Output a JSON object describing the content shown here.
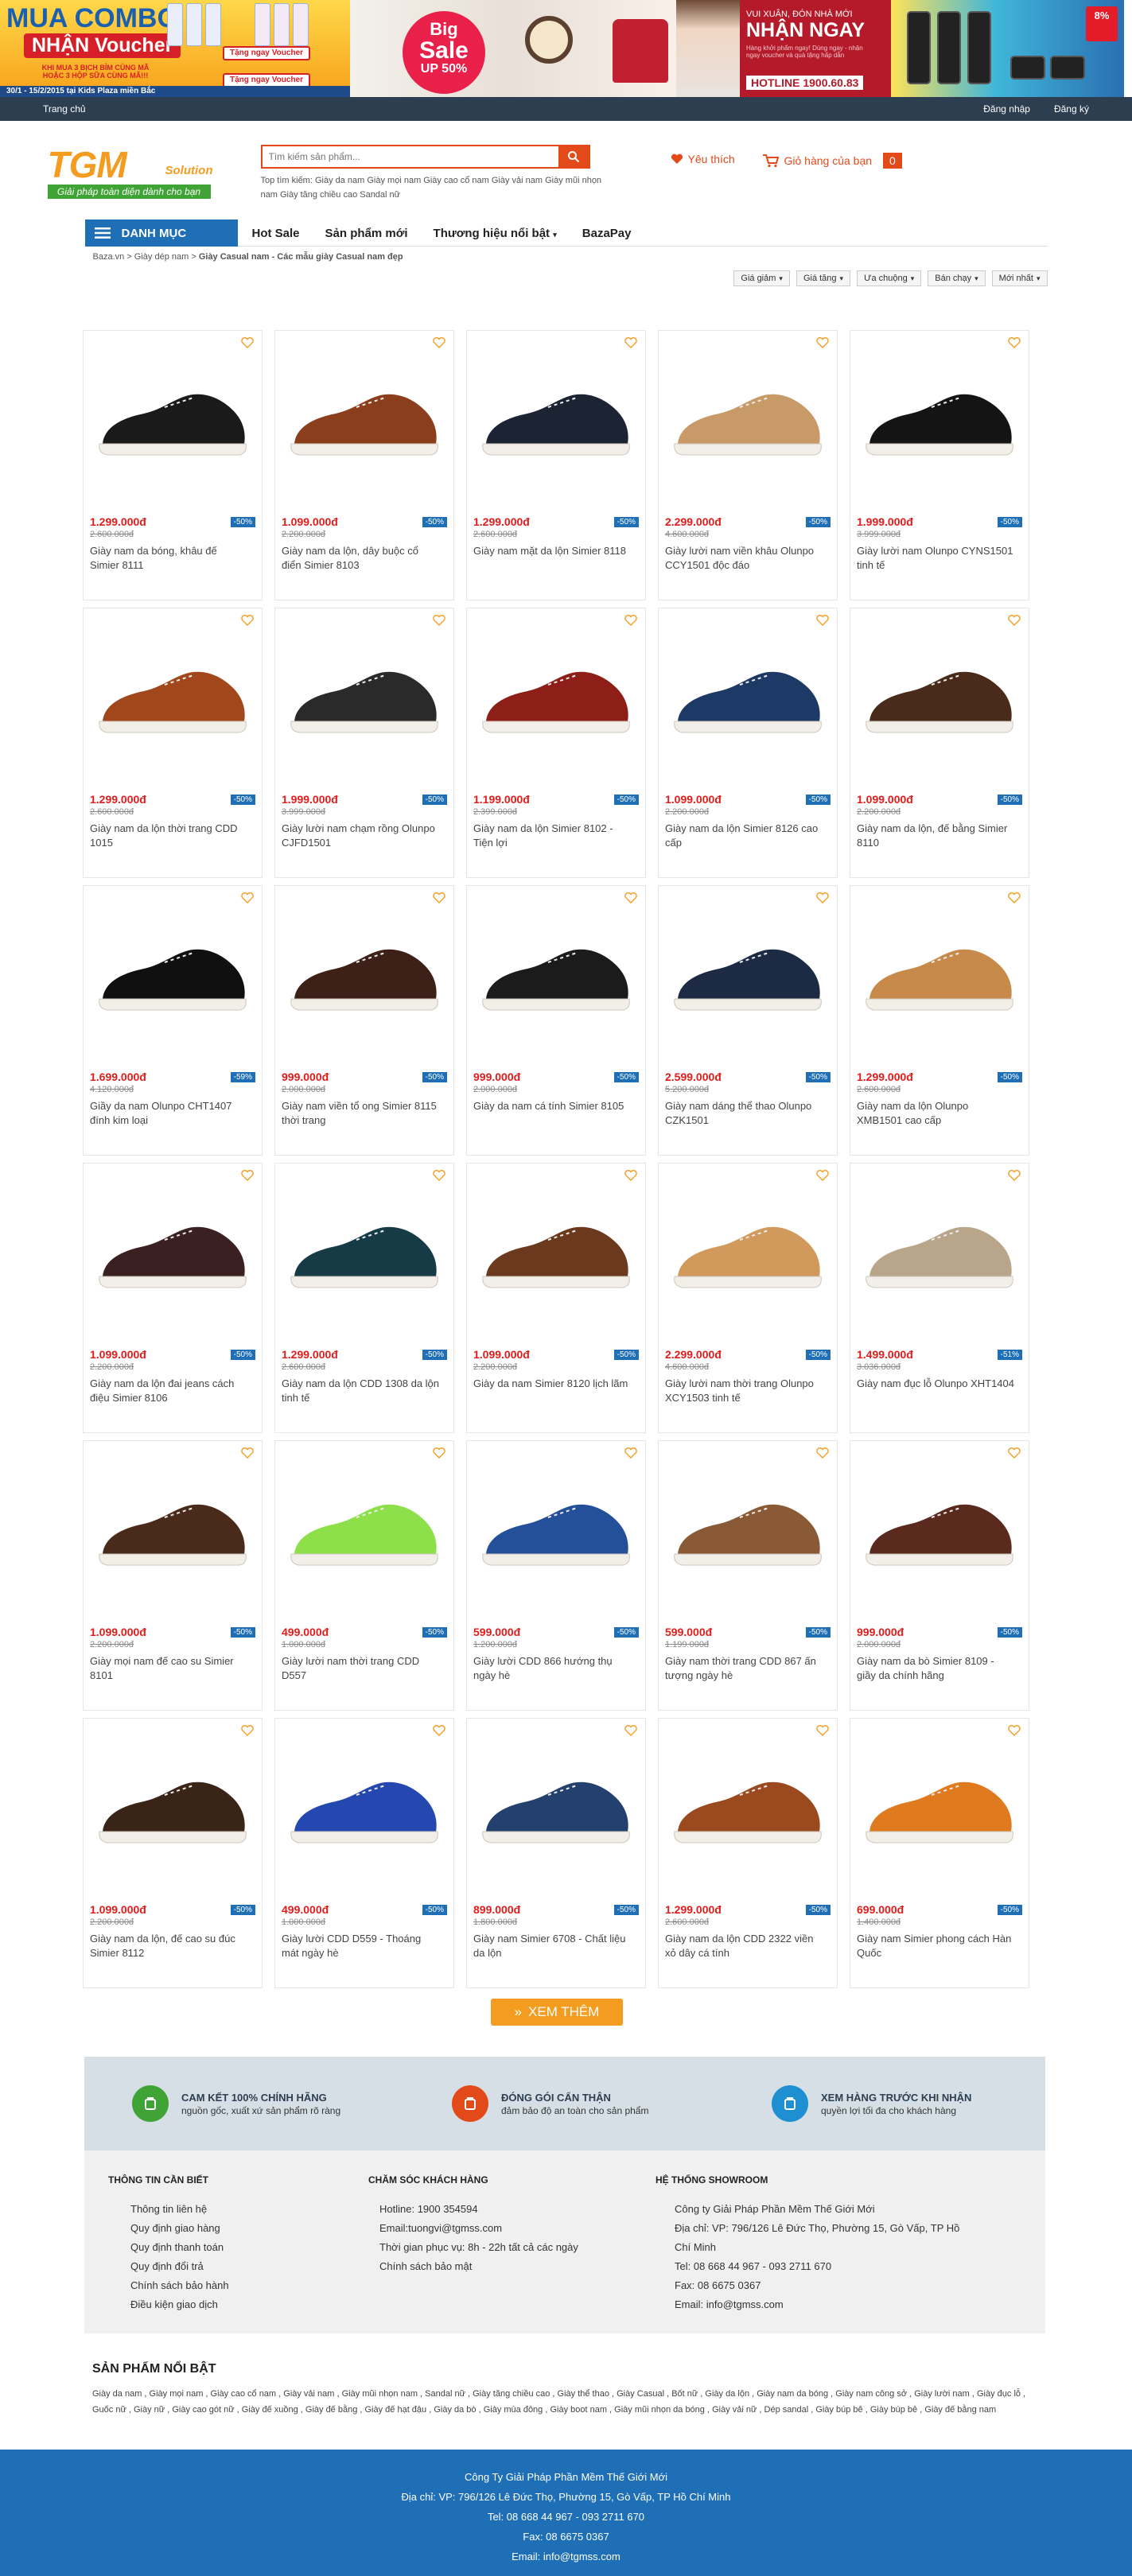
{
  "banner": {
    "combo_title": "MUA COMBO",
    "combo_voucher": "NHẬN Voucher",
    "combo_desc": "KHI MUA 3 BỊCH BỈM CÙNG MÃ HOẶC 3 HỘP SỮA CÙNG MÃ!!!",
    "combo_date": "30/1 - 15/2/2015 tại Kids Plaza miền Bắc",
    "voucher_label": "Tặng ngay Voucher",
    "sale_big": "Big",
    "sale_word": "Sale",
    "sale_pct": "UP 50%",
    "spring_l1": "VUI XUÂN, ĐÓN NHÀ MỚI",
    "spring_l2": "NHẬN NGAY",
    "spring_l3": "Hàng khởi phẩm ngay! Dùng ngay - nhận ngay voucher và quà tặng hấp dẫn",
    "hotline": "HOTLINE 1900.60.83",
    "badge": "8%"
  },
  "topbar": {
    "home": "Trang chủ",
    "login": "Đăng nhập",
    "register": "Đăng ký"
  },
  "logo": {
    "main": "TGM",
    "sub": "Solution",
    "tagline": "Giải pháp toàn diện dành cho bạn"
  },
  "search": {
    "placeholder": "Tìm kiếm sản phẩm...",
    "hot": "Top tìm kiếm: Giày da nam Giày mọi nam Giày cao cổ nam Giày vải nam Giày mũi nhọn nam Giày tăng chiều cao Sandal nữ"
  },
  "header": {
    "wishlist": "Yêu thích",
    "cart": "Giỏ hàng của bạn",
    "cart_count": "0"
  },
  "nav": {
    "category": "DANH MỤC",
    "items": [
      "Hot Sale",
      "Sản phẩm mới",
      "Thương hiệu nổi bật",
      "BazaPay"
    ]
  },
  "breadcrumb": [
    "Baza.vn",
    "Giày dép nam",
    "Giày Casual nam - Các mẫu giày Casual nam đẹp"
  ],
  "sort": [
    "Giá giảm",
    "Giá tăng",
    "Ưa chuộng",
    "Bán chạy",
    "Mới nhất"
  ],
  "products": [
    {
      "price": "1.299.000đ",
      "old": "2.600.000đ",
      "disc": "-50%",
      "name": "Giày nam da bóng, khâu đế Simier 8111",
      "color": "#1a1a1a"
    },
    {
      "price": "1.099.000đ",
      "old": "2.200.000đ",
      "disc": "-50%",
      "name": "Giày nam da lộn, dây buộc cổ điển Simier 8103",
      "color": "#8a3e1c"
    },
    {
      "price": "1.299.000đ",
      "old": "2.600.000đ",
      "disc": "-50%",
      "name": "Giày nam mặt da lộn Simier 8118",
      "color": "#1c2433"
    },
    {
      "price": "2.299.000đ",
      "old": "4.600.000đ",
      "disc": "-50%",
      "name": "Giày lười nam viền khâu Olunpo CCY1501 độc đáo",
      "color": "#c79a68"
    },
    {
      "price": "1.999.000đ",
      "old": "3.999.000đ",
      "disc": "-50%",
      "name": "Giày lười nam Olunpo CYNS1501 tinh tế",
      "color": "#141414"
    },
    {
      "price": "1.299.000đ",
      "old": "2.600.000đ",
      "disc": "-50%",
      "name": "Giày nam da lộn thời trang CDD 1015",
      "color": "#a2461c"
    },
    {
      "price": "1.999.000đ",
      "old": "3.999.000đ",
      "disc": "-50%",
      "name": "Giày lười nam chạm rồng Olunpo CJFD1501",
      "color": "#2a2a2a"
    },
    {
      "price": "1.199.000đ",
      "old": "2.399.000đ",
      "disc": "-50%",
      "name": "Giày nam da lộn Simier 8102 - Tiện lợi",
      "color": "#8e1f18"
    },
    {
      "price": "1.099.000đ",
      "old": "2.200.000đ",
      "disc": "-50%",
      "name": "Giày nam da lộn Simier 8126 cao cấp",
      "color": "#1d3a66"
    },
    {
      "price": "1.099.000đ",
      "old": "2.200.000đ",
      "disc": "-50%",
      "name": "Giày nam da lộn, đế bằng Simier 8110",
      "color": "#4a2a1a"
    },
    {
      "price": "1.699.000đ",
      "old": "4.120.000đ",
      "disc": "-59%",
      "name": "Giầy da nam Olunpo CHT1407 đính kim loại",
      "color": "#101010"
    },
    {
      "price": "999.000đ",
      "old": "2.000.000đ",
      "disc": "-50%",
      "name": "Giày nam viền tổ ong Simier 8115 thời trang",
      "color": "#3d2118"
    },
    {
      "price": "999.000đ",
      "old": "2.000.000đ",
      "disc": "-50%",
      "name": "Giày da nam cá tính Simier 8105",
      "color": "#1b1b1b"
    },
    {
      "price": "2.599.000đ",
      "old": "5.200.000đ",
      "disc": "-50%",
      "name": "Giày nam dáng thể thao Olunpo CZK1501",
      "color": "#1c2a44"
    },
    {
      "price": "1.299.000đ",
      "old": "2.600.000đ",
      "disc": "-50%",
      "name": "Giày nam da lộn Olunpo XMB1501 cao cấp",
      "color": "#c78a4a"
    },
    {
      "price": "1.099.000đ",
      "old": "2.200.000đ",
      "disc": "-50%",
      "name": "Giày nam da lộn đai jeans cách điệu Simier 8106",
      "color": "#3a2020"
    },
    {
      "price": "1.299.000đ",
      "old": "2.600.000đ",
      "disc": "-50%",
      "name": "Giày nam da lộn CDD 1308 da lộn tinh tế",
      "color": "#163a46"
    },
    {
      "price": "1.099.000đ",
      "old": "2.200.000đ",
      "disc": "-50%",
      "name": "Giày da nam Simier 8120 lịch lãm",
      "color": "#6b3a1e"
    },
    {
      "price": "2.299.000đ",
      "old": "4.600.000đ",
      "disc": "-50%",
      "name": "Giày lười nam thời trang Olunpo XCY1503 tinh tế",
      "color": "#d19a5c"
    },
    {
      "price": "1.499.000đ",
      "old": "3.036.000đ",
      "disc": "-51%",
      "name": "Giày nam đục lỗ Olunpo XHT1404",
      "color": "#b9a58a"
    },
    {
      "price": "1.099.000đ",
      "old": "2.200.000đ",
      "disc": "-50%",
      "name": "Giày mọi nam đế cao su Simier 8101",
      "color": "#4a2a1a"
    },
    {
      "price": "499.000đ",
      "old": "1.000.000đ",
      "disc": "-50%",
      "name": "Giày lười nam thời trang CDD D557",
      "color": "#8ee04a"
    },
    {
      "price": "599.000đ",
      "old": "1.200.000đ",
      "disc": "-50%",
      "name": "Giày lười CDD 866 hướng thụ ngày hè",
      "color": "#24509a"
    },
    {
      "price": "599.000đ",
      "old": "1.199.000đ",
      "disc": "-50%",
      "name": "Giày nam thời trang CDD 867 ấn tượng ngày hè",
      "color": "#8a5a36"
    },
    {
      "price": "999.000đ",
      "old": "2.000.000đ",
      "disc": "-50%",
      "name": "Giày nam da bò Simier 8109 - giầy da chính hãng",
      "color": "#5a2a1e"
    },
    {
      "price": "1.099.000đ",
      "old": "2.200.000đ",
      "disc": "-50%",
      "name": "Giày nam da lộn, đế cao su đúc Simier 8112",
      "color": "#3a2418"
    },
    {
      "price": "499.000đ",
      "old": "1.000.000đ",
      "disc": "-50%",
      "name": "Giày lười CDD D559 - Thoáng mát ngày hè",
      "color": "#2448b0"
    },
    {
      "price": "899.000đ",
      "old": "1.800.000đ",
      "disc": "-50%",
      "name": "Giày nam Simier 6708 - Chất liệu da lộn",
      "color": "#24406e"
    },
    {
      "price": "1.299.000đ",
      "old": "2.600.000đ",
      "disc": "-50%",
      "name": "Giày nam da lộn CDD 2322 viền xỏ dây cá tính",
      "color": "#9a4a1e"
    },
    {
      "price": "699.000đ",
      "old": "1.400.000đ",
      "disc": "-50%",
      "name": "Giày nam Simier phong cách Hàn Quốc",
      "color": "#e07a1e"
    }
  ],
  "more_label": "XEM THÊM",
  "commitments": [
    {
      "title": "CAM KẾT 100% CHÍNH HÃNG",
      "sub": "nguồn gốc, xuất xứ sản phẩm rõ ràng",
      "color": "#3fa336"
    },
    {
      "title": "ĐÓNG GÓI CẨN THẬN",
      "sub": "đảm bảo độ an toàn cho sản phẩm",
      "color": "#e34a1a"
    },
    {
      "title": "XEM HÀNG TRƯỚC KHI NHẬN",
      "sub": "quyền lợi tối đa cho khách hàng",
      "color": "#1e8fd0"
    }
  ],
  "info": {
    "col1_title": "THÔNG TIN CẦN BIẾT",
    "col1": [
      "Thông tin liên hệ",
      "Quy định giao hàng",
      "Quy định thanh toán",
      "Quy định đổi trả",
      "Chính sách bảo hành",
      "Điều kiện giao dịch"
    ],
    "col2_title": "CHĂM SÓC KHÁCH HÀNG",
    "col2": [
      "Hotline: 1900 354594",
      "Email:tuongvi@tgmss.com",
      "Thời gian phục vụ: 8h - 22h tất cả các ngày",
      "Chính sách bảo mật"
    ],
    "col3_title": "HỆ THỐNG SHOWROOM",
    "col3": [
      "Công ty Giải Pháp Phần Mềm Thế Giới Mới",
      "Địa chỉ: VP: 796/126 Lê Đức Thọ, Phường 15, Gò Vấp, TP Hồ Chí Minh",
      "Tel: 08 668 44 967 - 093 2711 670",
      "Fax: 08 6675 0367",
      "Email: info@tgmss.com"
    ]
  },
  "featured": {
    "title": "SẢN PHẨM NỔI BẬT",
    "text": "Giày da nam , Giày mọi nam , Giày cao cổ nam , Giày vải nam , Giày mũi nhọn nam , Sandal nữ , Giày tăng chiều cao , Giày thể thao , Giày Casual , Bốt nữ , Giày da lộn , Giày nam da bóng , Giày nam công sở , Giày lười nam , Giày đục lỗ , Guốc nữ , Giày nữ , Giày cao gót nữ , Giày đế xuồng , Giày đế bằng , Giày đế hạt đậu , Giày da bò , Giày mùa đông , Giày boot nam , Giày mũi nhọn da bóng , Giày vải nữ , Dép sandal , Giày búp bê , Giày búp bê , Giày đế bằng nam"
  },
  "footer": [
    "Công Ty Giải Pháp Phần Mềm Thế Giới Mới",
    "Địa chỉ: VP: 796/126 Lê Đức Thọ, Phường 15, Gò Vấp, TP Hồ Chí Minh",
    "Tel: 08 668 44 967 - 093 2711 670",
    "Fax: 08 6675 0367",
    "Email: info@tgmss.com"
  ]
}
